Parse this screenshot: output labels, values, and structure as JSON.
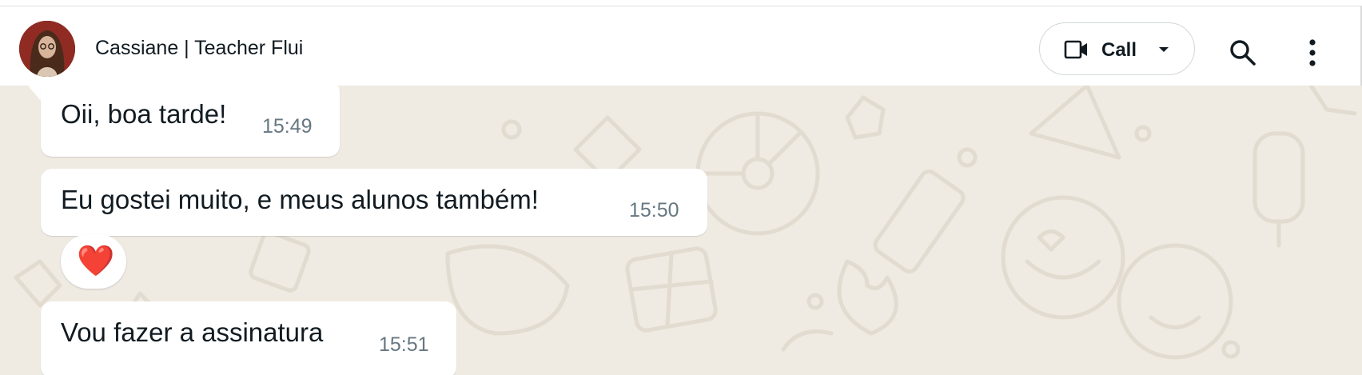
{
  "header": {
    "contact_name": "Cassiane | Teacher Flui",
    "call_label": "Call"
  },
  "messages": [
    {
      "text": "Oii, boa tarde!",
      "time": "15:49"
    },
    {
      "text": "Eu gostei muito, e meus alunos também!",
      "time": "15:50",
      "reaction": "❤️"
    },
    {
      "text": "Vou fazer a assinatura",
      "time": "15:51"
    }
  ],
  "icons": {
    "call": "video-camera-icon",
    "dropdown": "caret-down-icon",
    "search": "search-icon",
    "menu": "kebab-menu-icon",
    "reaction": "red-heart"
  },
  "colors": {
    "chat_background": "#efeae2",
    "bubble": "#ffffff",
    "timestamp": "#667781",
    "text": "#111b21",
    "heart": "#e0202f"
  }
}
